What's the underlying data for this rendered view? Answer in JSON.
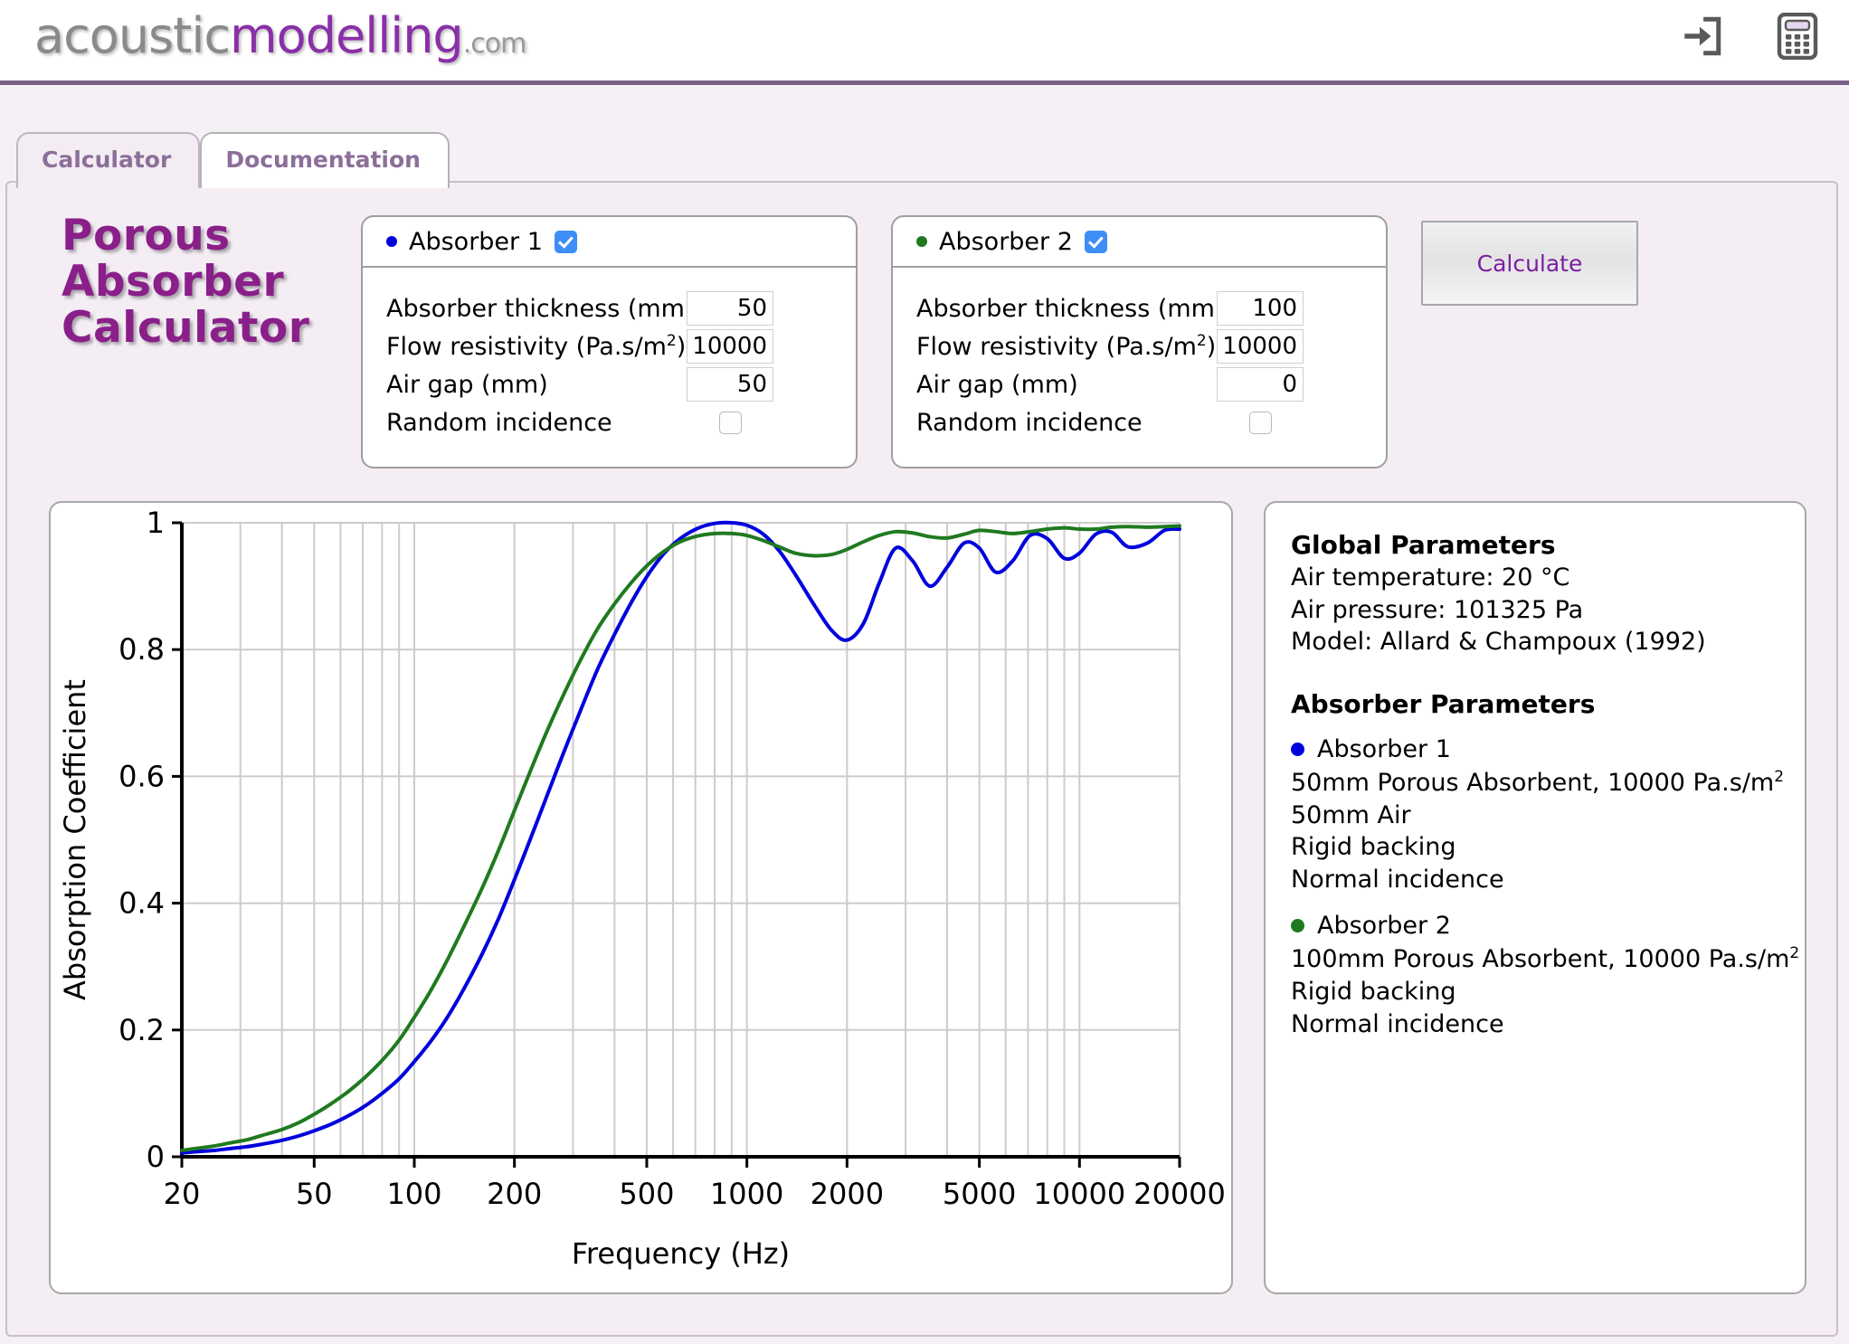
{
  "header": {
    "logo_part1": "acoustic",
    "logo_part2": "modelling",
    "logo_part3": ".com",
    "login_icon": "login-arrow-icon",
    "calculator_icon": "calculator-icon",
    "accent_color": "#7a5f87",
    "logo_purple": "#8a2fa8"
  },
  "tabs": [
    {
      "label": "Calculator",
      "active": true
    },
    {
      "label": "Documentation",
      "active": false
    }
  ],
  "page_title": "Porous\nAbsorber\nCalculator",
  "page_title_lines": [
    "Porous",
    "Absorber",
    "Calculator"
  ],
  "absorbers": [
    {
      "title": "Absorber 1",
      "bullet_color": "#0000dd",
      "enabled": true,
      "fields": [
        {
          "label": "Absorber thickness (mm)",
          "value": "50",
          "type": "number"
        },
        {
          "label": "Flow resistivity (Pa.s/m",
          "sup": "2",
          "label_end": ")",
          "value": "10000",
          "type": "number"
        },
        {
          "label": "Air gap (mm)",
          "value": "50",
          "type": "number"
        },
        {
          "label": "Random incidence",
          "value": false,
          "type": "checkbox"
        }
      ]
    },
    {
      "title": "Absorber 2",
      "bullet_color": "#1f7a1f",
      "enabled": true,
      "fields": [
        {
          "label": "Absorber thickness (mm)",
          "value": "100",
          "type": "number"
        },
        {
          "label": "Flow resistivity (Pa.s/m",
          "sup": "2",
          "label_end": ")",
          "value": "10000",
          "type": "number"
        },
        {
          "label": "Air gap (mm)",
          "value": "0",
          "type": "number"
        },
        {
          "label": "Random incidence",
          "value": false,
          "type": "checkbox"
        }
      ]
    }
  ],
  "calculate_button": "Calculate",
  "results": {
    "global_heading": "Global Parameters",
    "global_lines": [
      "Air temperature: 20 °C",
      "Air pressure: 101325 Pa",
      "Model: Allard & Champoux (1992)"
    ],
    "absorber_heading": "Absorber Parameters",
    "entries": [
      {
        "name": "Absorber 1",
        "color": "#0000dd",
        "lines": [
          {
            "text": "50mm Porous Absorbent, 10000 Pa.s/m",
            "sup": "2"
          },
          {
            "text": "50mm Air"
          },
          {
            "text": "Rigid backing"
          },
          {
            "text": "Normal incidence"
          }
        ]
      },
      {
        "name": "Absorber 2",
        "color": "#1f7a1f",
        "lines": [
          {
            "text": "100mm Porous Absorbent, 10000 Pa.s/m",
            "sup": "2"
          },
          {
            "text": "Rigid backing"
          },
          {
            "text": "Normal incidence"
          }
        ]
      }
    ]
  },
  "chart_data": {
    "type": "line",
    "title": "",
    "xlabel": "Frequency (Hz)",
    "ylabel": "Absorption Coefficient",
    "xscale": "log",
    "xlim": [
      20,
      20000
    ],
    "ylim": [
      0,
      1
    ],
    "xticks": [
      20,
      50,
      100,
      200,
      500,
      1000,
      2000,
      5000,
      10000,
      20000
    ],
    "xtick_labels": [
      "20",
      "50",
      "100",
      "200",
      "500",
      "1000",
      "2000",
      "5000",
      "10000",
      "20000"
    ],
    "yticks": [
      0,
      0.2,
      0.4,
      0.6,
      0.8,
      1
    ],
    "ytick_labels": [
      "0",
      "0.2",
      "0.4",
      "0.6",
      "0.8",
      "1"
    ],
    "grid": true,
    "legend_position": "external-panel",
    "series": [
      {
        "name": "Absorber 1",
        "color": "#0000dd",
        "x": [
          20,
          22,
          25,
          28,
          31.5,
          35,
          40,
          45,
          50,
          56,
          63,
          71,
          80,
          90,
          100,
          112,
          125,
          140,
          160,
          180,
          200,
          224,
          250,
          280,
          315,
          355,
          400,
          450,
          500,
          560,
          630,
          710,
          800,
          900,
          1000,
          1120,
          1250,
          1400,
          1600,
          1800,
          2000,
          2240,
          2500,
          2800,
          3150,
          3550,
          4000,
          4500,
          5000,
          5600,
          6300,
          7100,
          8000,
          9000,
          10000,
          11200,
          12500,
          14000,
          16000,
          18000,
          20000
        ],
        "y": [
          0.006,
          0.008,
          0.01,
          0.013,
          0.016,
          0.02,
          0.026,
          0.033,
          0.041,
          0.051,
          0.064,
          0.08,
          0.1,
          0.123,
          0.15,
          0.182,
          0.218,
          0.262,
          0.32,
          0.378,
          0.437,
          0.503,
          0.568,
          0.635,
          0.702,
          0.768,
          0.824,
          0.875,
          0.915,
          0.95,
          0.975,
          0.991,
          0.999,
          1.0,
          0.996,
          0.982,
          0.956,
          0.918,
          0.869,
          0.83,
          0.815,
          0.841,
          0.905,
          0.96,
          0.94,
          0.9,
          0.93,
          0.968,
          0.96,
          0.922,
          0.94,
          0.98,
          0.975,
          0.944,
          0.952,
          0.982,
          0.985,
          0.962,
          0.968,
          0.988,
          0.99
        ],
        "description": "50mm porous absorbent with 50mm air gap, rigid backing, normal incidence"
      },
      {
        "name": "Absorber 2",
        "color": "#1f7a1f",
        "x": [
          20,
          22,
          25,
          28,
          31.5,
          35,
          40,
          45,
          50,
          56,
          63,
          71,
          80,
          90,
          100,
          112,
          125,
          140,
          160,
          180,
          200,
          224,
          250,
          280,
          315,
          355,
          400,
          450,
          500,
          560,
          630,
          710,
          800,
          900,
          1000,
          1120,
          1250,
          1400,
          1600,
          1800,
          2000,
          2240,
          2500,
          2800,
          3150,
          3550,
          4000,
          4500,
          5000,
          5600,
          6300,
          7100,
          8000,
          9000,
          10000,
          11200,
          12500,
          14000,
          16000,
          18000,
          20000
        ],
        "y": [
          0.01,
          0.013,
          0.017,
          0.022,
          0.027,
          0.034,
          0.043,
          0.054,
          0.067,
          0.083,
          0.102,
          0.125,
          0.152,
          0.184,
          0.22,
          0.262,
          0.308,
          0.36,
          0.424,
          0.486,
          0.546,
          0.61,
          0.67,
          0.727,
          0.782,
          0.832,
          0.872,
          0.906,
          0.932,
          0.954,
          0.97,
          0.979,
          0.983,
          0.983,
          0.98,
          0.972,
          0.962,
          0.952,
          0.948,
          0.95,
          0.958,
          0.97,
          0.98,
          0.986,
          0.984,
          0.978,
          0.976,
          0.982,
          0.988,
          0.986,
          0.983,
          0.986,
          0.99,
          0.992,
          0.99,
          0.99,
          0.993,
          0.994,
          0.993,
          0.994,
          0.995
        ],
        "description": "100mm porous absorbent, rigid backing, normal incidence"
      }
    ]
  }
}
